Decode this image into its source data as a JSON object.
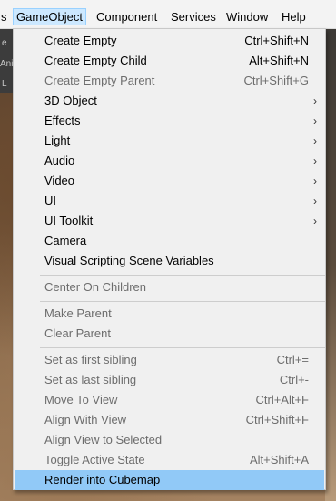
{
  "menubar": {
    "items": [
      {
        "label": "s"
      },
      {
        "label": "GameObject"
      },
      {
        "label": "Component"
      },
      {
        "label": "Services"
      },
      {
        "label": "Window"
      },
      {
        "label": "Help"
      }
    ],
    "active_index": 1
  },
  "toolbar": {
    "glyph1": "e",
    "glyph2": "Ani",
    "glyph3": "L"
  },
  "menu": {
    "items": [
      {
        "label": "Create Empty",
        "shortcut": "Ctrl+Shift+N",
        "enabled": true
      },
      {
        "label": "Create Empty Child",
        "shortcut": "Alt+Shift+N",
        "enabled": true
      },
      {
        "label": "Create Empty Parent",
        "shortcut": "Ctrl+Shift+G",
        "enabled": false
      },
      {
        "label": "3D Object",
        "submenu": true,
        "enabled": true
      },
      {
        "label": "Effects",
        "submenu": true,
        "enabled": true
      },
      {
        "label": "Light",
        "submenu": true,
        "enabled": true
      },
      {
        "label": "Audio",
        "submenu": true,
        "enabled": true
      },
      {
        "label": "Video",
        "submenu": true,
        "enabled": true
      },
      {
        "label": "UI",
        "submenu": true,
        "enabled": true
      },
      {
        "label": "UI Toolkit",
        "submenu": true,
        "enabled": true
      },
      {
        "label": "Camera",
        "enabled": true
      },
      {
        "label": "Visual Scripting Scene Variables",
        "enabled": true
      },
      {
        "label": "Center On Children",
        "enabled": false
      },
      {
        "label": "Make Parent",
        "enabled": false
      },
      {
        "label": "Clear Parent",
        "enabled": false
      },
      {
        "label": "Set as first sibling",
        "shortcut": "Ctrl+=",
        "enabled": false
      },
      {
        "label": "Set as last sibling",
        "shortcut": "Ctrl+-",
        "enabled": false
      },
      {
        "label": "Move To View",
        "shortcut": "Ctrl+Alt+F",
        "enabled": false
      },
      {
        "label": "Align With View",
        "shortcut": "Ctrl+Shift+F",
        "enabled": false
      },
      {
        "label": "Align View to Selected",
        "enabled": false
      },
      {
        "label": "Toggle Active State",
        "shortcut": "Alt+Shift+A",
        "enabled": false
      },
      {
        "label": "Render into Cubemap",
        "enabled": true,
        "highlighted": true
      }
    ],
    "arrow_glyph": "›"
  },
  "colors": {
    "menu_background": "#f0f0f0",
    "highlight": "#91c9f7",
    "disabled_text": "#6d6d6d",
    "menubar_active": "#cce8ff"
  }
}
